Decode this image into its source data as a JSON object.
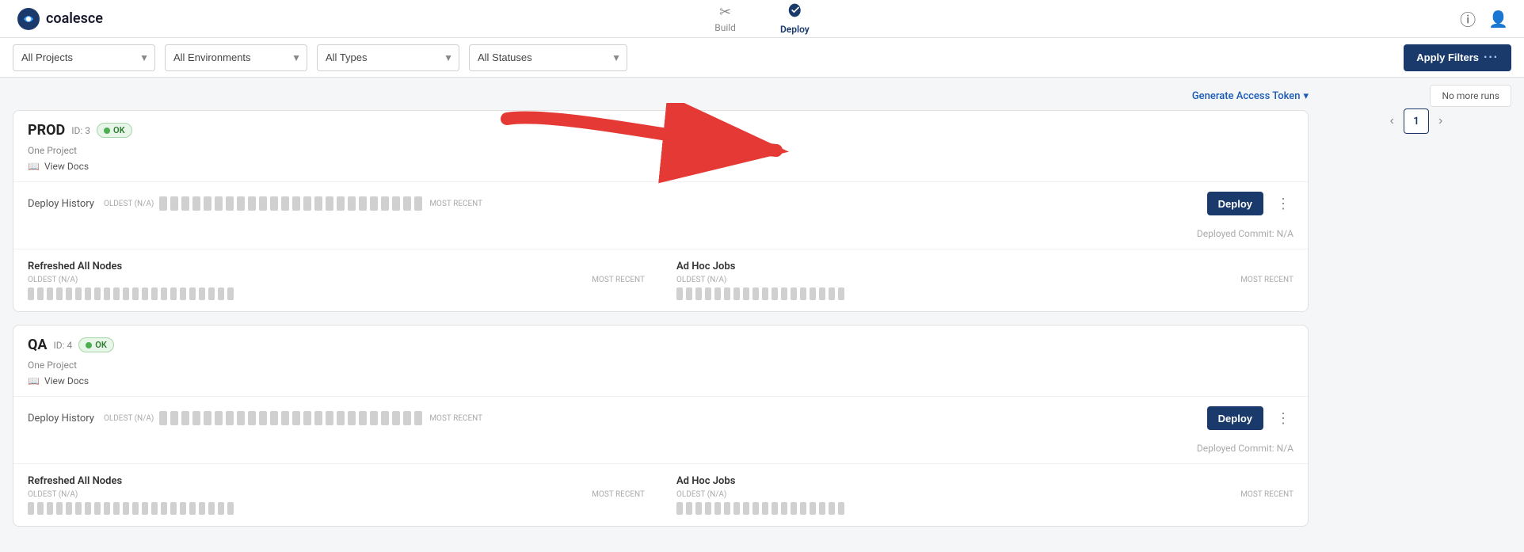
{
  "logo": {
    "text": "coalesce"
  },
  "nav": {
    "items": [
      {
        "id": "build",
        "label": "Build",
        "icon": "⚙",
        "active": false
      },
      {
        "id": "deploy",
        "label": "Deploy",
        "icon": "🚀",
        "active": true
      }
    ]
  },
  "filters": {
    "projects": {
      "label": "All Projects",
      "options": [
        "All Projects"
      ]
    },
    "environments": {
      "label": "All Environments",
      "options": [
        "All Environments"
      ]
    },
    "types": {
      "label": "All Types",
      "options": [
        "All Types"
      ]
    },
    "statuses": {
      "label": "All Statuses",
      "options": [
        "All Statuses"
      ]
    },
    "apply_button": "Apply Filters"
  },
  "generate_token": {
    "label": "Generate Access Token"
  },
  "environments": [
    {
      "id": "prod",
      "name": "PROD",
      "id_label": "ID: 3",
      "status": "OK",
      "project": "One Project",
      "deploy_history_label": "Deploy History",
      "oldest_label": "OLDEST (N/A)",
      "most_recent_label": "MOST RECENT",
      "deploy_button": "Deploy",
      "deployed_commit": "Deployed Commit: N/A",
      "jobs": [
        {
          "title": "Refreshed All Nodes",
          "oldest": "OLDEST (N/A)",
          "most_recent": "MOST RECENT",
          "bars": 22
        },
        {
          "title": "Ad Hoc Jobs",
          "oldest": "OLDEST (N/A)",
          "most_recent": "MOST RECENT",
          "bars": 18
        }
      ]
    },
    {
      "id": "qa",
      "name": "QA",
      "id_label": "ID: 4",
      "status": "OK",
      "project": "One Project",
      "deploy_history_label": "Deploy History",
      "oldest_label": "OLDEST (N/A)",
      "most_recent_label": "MOST RECENT",
      "deploy_button": "Deploy",
      "deployed_commit": "Deployed Commit: N/A",
      "jobs": [
        {
          "title": "Refreshed All Nodes",
          "oldest": "OLDEST (N/A)",
          "most_recent": "MOST RECENT",
          "bars": 22
        },
        {
          "title": "Ad Hoc Jobs",
          "oldest": "OLDEST (N/A)",
          "most_recent": "MOST RECENT",
          "bars": 18
        }
      ]
    }
  ],
  "right_panel": {
    "no_more_runs": "No more runs",
    "page": "1"
  }
}
